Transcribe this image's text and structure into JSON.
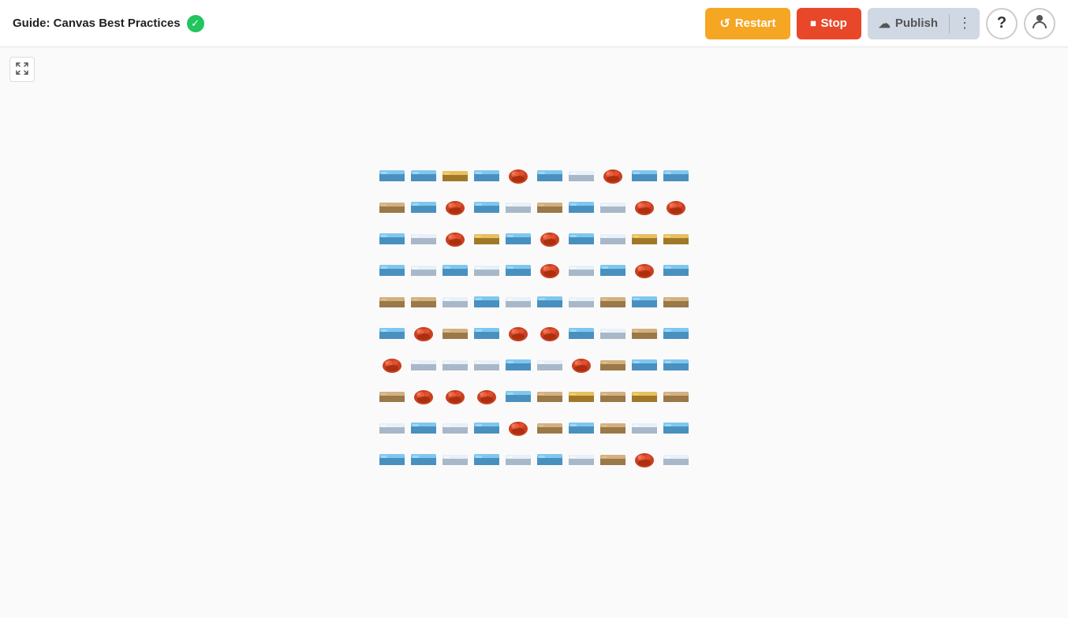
{
  "header": {
    "title": "Guide: Canvas Best Practices",
    "status_icon": "✓",
    "restart_label": "Restart",
    "stop_label": "Stop",
    "publish_label": "Publish",
    "help_icon": "?",
    "user_icon": "👤"
  },
  "toolbar": {
    "collapse_icon": "⤢"
  },
  "canvas": {
    "background": "#fafafa"
  },
  "pixel_items": {
    "blue_bar": "🧊",
    "gold_bar": "🪙",
    "red_pile": "🔴",
    "items": [
      [
        "💠",
        "🧊",
        "🥇",
        "🧊",
        "🔶",
        "🧊",
        "⬜",
        "🔶",
        "🧊"
      ],
      [
        "🟫",
        "🧊",
        "🔶",
        "🧊",
        "⬜",
        "🟫",
        "🧊",
        "⬜",
        "🔶",
        "🔶"
      ],
      [
        "🧊",
        "⬜",
        "🔶",
        "🥇",
        "🧊",
        "🔶",
        "🧊",
        "⬜",
        "🥇"
      ],
      [
        "🧊",
        "⬜",
        "🧊",
        "⬜",
        "🧊",
        "🔶",
        "⬜",
        "🧊",
        "🔶",
        "🧊"
      ],
      [
        "🟫",
        "🟫",
        "⬜",
        "🧊",
        "⬜",
        "🧊",
        "⬜",
        "🟫",
        "🧊"
      ],
      [
        "🧊",
        "🔶",
        "🟫",
        "🧊",
        "🔶",
        "🔶",
        "🧊",
        "⬜",
        "🟫"
      ],
      [
        "🔶",
        "⬜",
        "⬜",
        "⬜",
        "🧊",
        "⬜",
        "🔶",
        "🟫",
        "🧊"
      ],
      [
        "🟫",
        "🔶",
        "🔶",
        "🔶",
        "🧊",
        "🟫",
        "🥇",
        "🟫"
      ],
      [
        "⬜",
        "🧊",
        "⬜",
        "🧊",
        "🔶",
        "🟫",
        "🧊",
        "🟫",
        "⬜",
        "🧊"
      ],
      [
        "🧊",
        "🧊",
        "⬜",
        "🧊",
        "⬜",
        "🧊",
        "⬜",
        "🟫",
        "🔶",
        "⬜"
      ]
    ]
  }
}
